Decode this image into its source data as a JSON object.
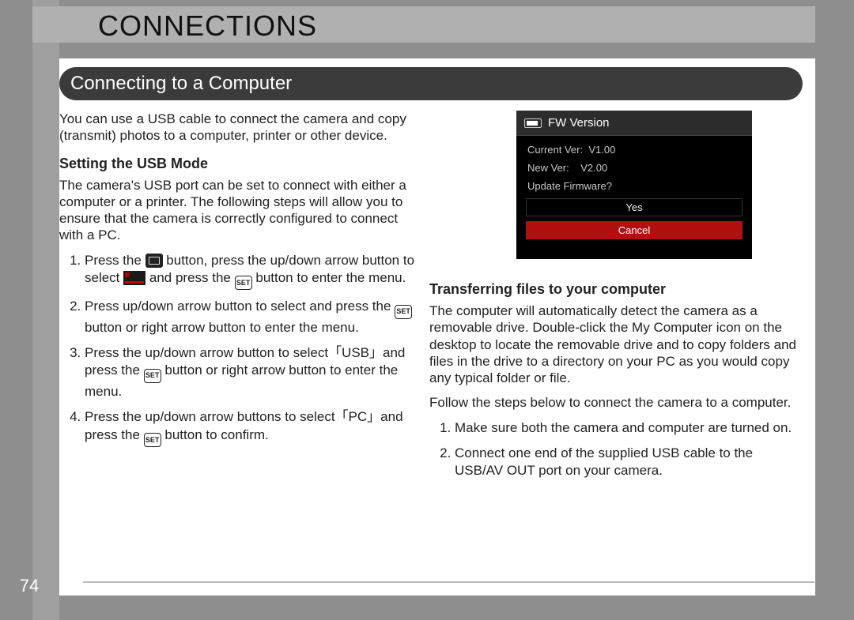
{
  "page_number": "74",
  "title": "CONNECTIONS",
  "subtitle": "Connecting to a Computer",
  "intro": "You can use a USB cable to connect the camera and copy (transmit) photos to a computer, printer or other device.",
  "left": {
    "heading": "Setting the USB Mode",
    "para": "The camera's USB port can be set to connect with either a computer or a printer. The following steps will allow you to ensure that the camera is correctly configured to connect with a PC.",
    "steps": {
      "s1a": "Press the ",
      "s1b": " button, press the up/down arrow button to select ",
      "s1c": " and press the ",
      "s1d": " button to enter the menu.",
      "s2a": "Press up/down arrow button to select     and press the ",
      "s2b": " button or right arrow button to enter the menu.",
      "s3a": "Press the up/down arrow button to select「USB」and press the ",
      "s3b": " button or right arrow button to enter the menu.",
      "s4a": "Press the up/down arrow buttons to select「PC」and press the ",
      "s4b": " button to confirm."
    },
    "set_label": "SET"
  },
  "right": {
    "heading": "Transferring files to your computer",
    "para1": "The computer will automatically detect the camera as a removable drive. Double-click the My Computer icon on the desktop to locate the removable drive and to copy folders and files in the drive to a directory on your PC as you would copy any typical folder or file.",
    "para2": "Follow the steps below to connect the camera to a computer.",
    "steps": [
      "Make sure both the camera and computer are turned on.",
      "Connect one end of the supplied USB cable to the USB/AV OUT port on your camera."
    ]
  },
  "osd": {
    "title": "FW Version",
    "rows": {
      "current_label": "Current Ver:",
      "current_value": "V1.00",
      "new_label": "New Ver:",
      "new_value": "V2.00",
      "prompt": "Update Firmware?"
    },
    "yes": "Yes",
    "cancel": "Cancel"
  }
}
